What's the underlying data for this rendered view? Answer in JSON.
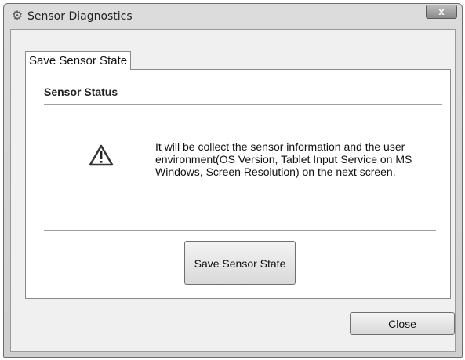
{
  "window": {
    "title": "Sensor Diagnostics",
    "app_icon": "gear-icon",
    "close_glyph": "x"
  },
  "tab": {
    "label": "Save Sensor State"
  },
  "group": {
    "title": "Sensor Status"
  },
  "warning": {
    "icon": "warning-icon",
    "message": "It will be collect the sensor information and the user environment(OS Version, Tablet Input Service on MS Windows, Screen Resolution) on the next screen."
  },
  "buttons": {
    "save_label": "Save Sensor State",
    "close_label": "Close"
  }
}
